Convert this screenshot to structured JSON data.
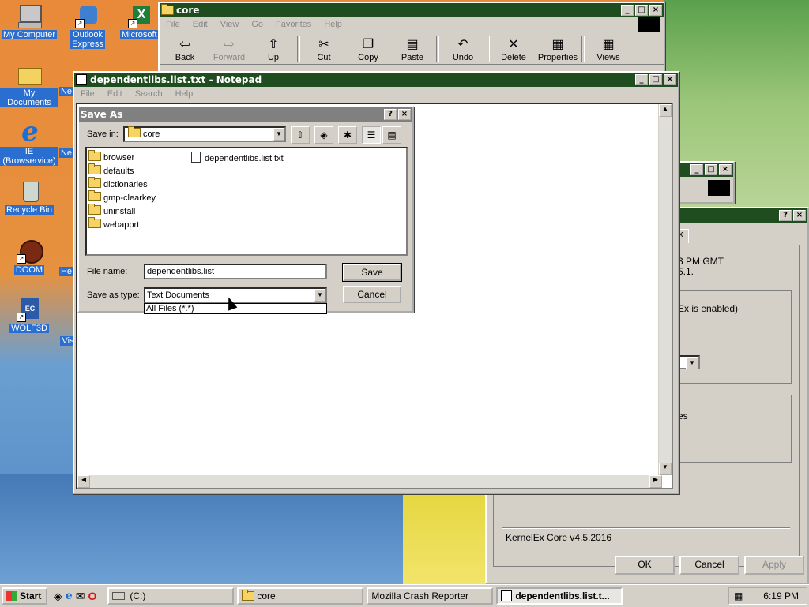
{
  "desktop": {
    "icons": [
      {
        "label": "My Computer"
      },
      {
        "label": "Outlook Express"
      },
      {
        "label": "Microsoft Excel"
      },
      {
        "label": "My Documents"
      },
      {
        "label": "Ne"
      },
      {
        "label": "IE (Browservice)"
      },
      {
        "label": "Ne"
      },
      {
        "label": "Recycle Bin"
      },
      {
        "label": "DOOM"
      },
      {
        "label": "He"
      },
      {
        "label": "WOLF3D"
      },
      {
        "label": "Vis"
      }
    ]
  },
  "explorer": {
    "title": "core",
    "menu": [
      "File",
      "Edit",
      "View",
      "Go",
      "Favorites",
      "Help"
    ],
    "toolbar": [
      "Back",
      "Forward",
      "Up",
      "Cut",
      "Copy",
      "Paste",
      "Undo",
      "Delete",
      "Properties",
      "Views"
    ]
  },
  "notepad": {
    "title": "dependentlibs.list.txt - Notepad",
    "menu": [
      "File",
      "Edit",
      "Search",
      "Help"
    ]
  },
  "saveas": {
    "title": "Save As",
    "save_in_label": "Save in:",
    "save_in_value": "core",
    "folders": [
      "browser",
      "defaults",
      "dictionaries",
      "gmp-clearkey",
      "uninstall",
      "webapprt"
    ],
    "files": [
      "dependentlibs.list.txt"
    ],
    "filename_label": "File name:",
    "filename_value": "dependentlibs.list",
    "savetype_label": "Save as type:",
    "savetype_value": "Text Documents",
    "savetype_option": "All Files (*.*)",
    "save_button": "Save",
    "cancel_button": "Cancel"
  },
  "kernelex": {
    "tab": "x",
    "line1": "3 PM GMT",
    "line2": "5.1.",
    "line3": "Ex is enabled)",
    "line4": "es",
    "version": "KernelEx Core v4.5.2016",
    "ok": "OK",
    "cancel": "Cancel",
    "apply": "Apply"
  },
  "taskbar": {
    "start": "Start",
    "tasks": [
      "(C:)",
      "core",
      "Mozilla Crash Reporter",
      "dependentlibs.list.t..."
    ],
    "clock": "6:19 PM"
  }
}
